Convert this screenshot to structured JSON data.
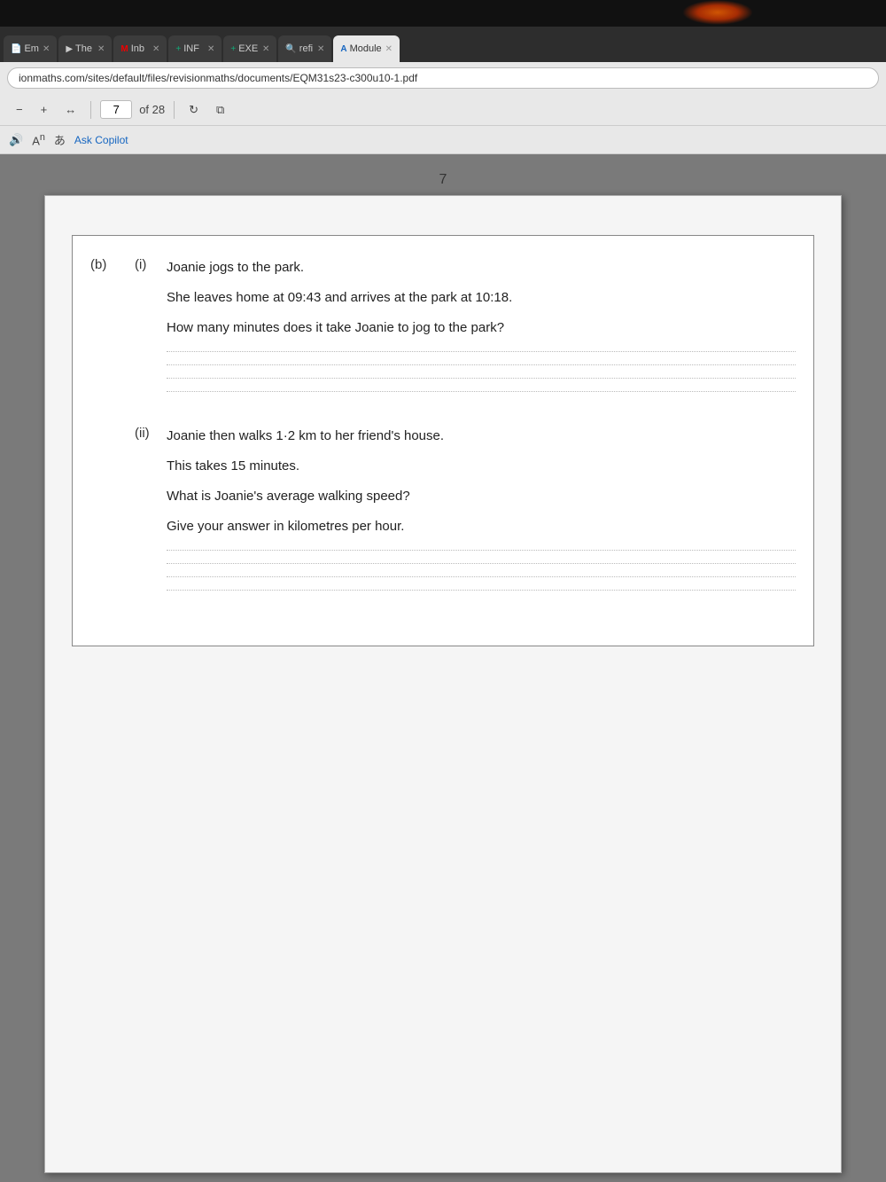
{
  "topBar": {
    "orangeGlow": true
  },
  "browser": {
    "tabs": [
      {
        "id": "em",
        "label": "Em",
        "icon": "📄",
        "active": false,
        "close": true
      },
      {
        "id": "the",
        "label": "The",
        "icon": "▶",
        "active": false,
        "close": true
      },
      {
        "id": "inb",
        "label": "Inb",
        "icon": "M",
        "active": false,
        "close": true
      },
      {
        "id": "inf",
        "label": "INF",
        "icon": "+",
        "active": false,
        "close": true
      },
      {
        "id": "exe",
        "label": "EXE",
        "icon": "+",
        "active": false,
        "close": true
      },
      {
        "id": "refi",
        "label": "refi",
        "icon": "🔍",
        "active": false,
        "close": true
      },
      {
        "id": "module",
        "label": "Module",
        "icon": "A",
        "active": true,
        "close": true
      }
    ],
    "addressBar": "ionmaths.com/sites/default/files/revisionmaths/documents/EQM31s23-c300u10-1.pdf"
  },
  "pdfToolbar": {
    "zoomOut": "−",
    "zoomIn": "+",
    "fitIcon": "↔",
    "currentPage": "7",
    "totalPages": "of 28",
    "rotateIcon": "↻",
    "layoutIcon": "⧉"
  },
  "readerToolbar": {
    "readAloudIcon": "🔊",
    "fontSizeLabel": "Aⁿ",
    "readingModeLabel": "あ",
    "askCopilot": "Ask Copilot"
  },
  "pdf": {
    "pageNumber": "7",
    "parts": [
      {
        "id": "b",
        "label": "(b)",
        "subParts": [
          {
            "id": "i",
            "label": "(i)",
            "text1": "Joanie jogs to the park.",
            "text2": "She leaves home at 09:43 and arrives at the park at 10:18.",
            "question": "How many minutes does it take Joanie to jog to the park?",
            "answerLines": 4
          },
          {
            "id": "ii",
            "label": "(ii)",
            "text1": "Joanie then walks 1·2 km to her friend's house.",
            "text2": "This takes 15 minutes.",
            "question1": "What is Joanie's average walking speed?",
            "question2": "Give your answer in kilometres per hour.",
            "answerLines": 4
          }
        ]
      }
    ]
  }
}
